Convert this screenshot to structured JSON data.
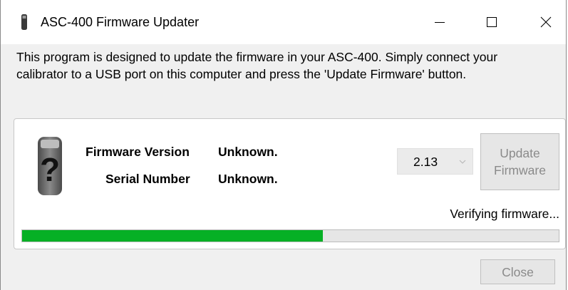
{
  "window": {
    "title": "ASC-400 Firmware Updater",
    "app_icon": "device-icon",
    "controls": {
      "minimize_icon": "minimize-icon",
      "maximize_icon": "maximize-icon",
      "close_icon": "close-icon"
    }
  },
  "description": "This program is designed to update the firmware in your ASC-400.  Simply connect your calibrator to a USB port on this computer and press the 'Update Firmware' button.",
  "device": {
    "image_icon": "unknown-device-icon",
    "firmware_label": "Firmware Version",
    "firmware_value": "Unknown.",
    "serial_label": "Serial Number",
    "serial_value": "Unknown."
  },
  "version_select": {
    "selected": "2.13",
    "enabled": false
  },
  "update_button": {
    "line1": "Update",
    "line2": "Firmware",
    "enabled": false
  },
  "status": {
    "text": "Verifying firmware...",
    "progress_fraction": 0.56,
    "progress_color": "#06b025"
  },
  "close_button": {
    "label": "Close",
    "enabled": false
  }
}
